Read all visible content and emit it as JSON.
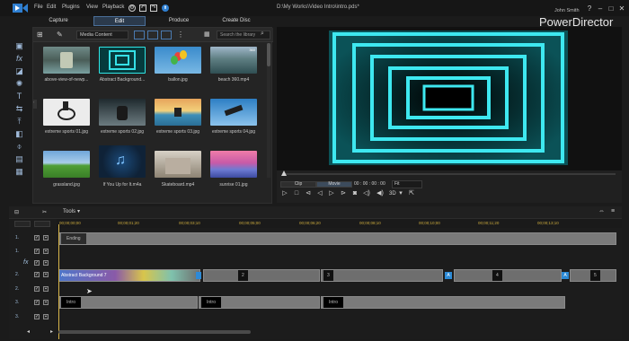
{
  "titlebar": {
    "menus": [
      "File",
      "Edit",
      "Plugins",
      "View",
      "Playback"
    ],
    "file_path": "D:\\My Works\\Video Intro\\intro.pds*",
    "user": "John Smith",
    "brand": "PowerDirector"
  },
  "modes": [
    "Capture",
    "Edit",
    "Produce",
    "Create Disc"
  ],
  "library": {
    "content_type": "Media Content",
    "search_placeholder": "Search the library",
    "items": [
      {
        "label": "above-view-of-newp..."
      },
      {
        "label": "Abstract Background..."
      },
      {
        "label": "ballon.jpg"
      },
      {
        "label": "beach 360.mp4",
        "badge": "360"
      },
      {
        "label": "extreme sports 01.jpg"
      },
      {
        "label": "extreme sports 02.jpg"
      },
      {
        "label": "extreme sports 03.jpg"
      },
      {
        "label": "extreme sports 04.jpg"
      },
      {
        "label": "grassland.jpg"
      },
      {
        "label": "If You Up for It.m4a"
      },
      {
        "label": "Skateboard.mp4"
      },
      {
        "label": "sunrise 01.jpg"
      }
    ]
  },
  "preview": {
    "modes": [
      "Clip",
      "Movie"
    ],
    "timecode": "00 : 00 : 00 : 00",
    "fit": "Fit",
    "three_d": "3D"
  },
  "timeline": {
    "tools_label": "Tools",
    "tracks": [
      "1.",
      "1.",
      "2.",
      "2.",
      "3.",
      "3."
    ],
    "ruler_ticks": [
      "00;00;00;00",
      "00;00;01;20",
      "00;00;03;10",
      "00;00;05;00",
      "00;00;06;20",
      "00;00;08;10",
      "00;00;10;00",
      "00;00;11;20",
      "00;00;13;10"
    ],
    "clip_labels": {
      "video1": "Ending",
      "fx_track": "Abstract Background 7",
      "seg2": "2",
      "seg3": "3",
      "seg4": "4",
      "seg5": "5",
      "audio3a": "Intro",
      "audio3b": "Intro",
      "audio3c": "Intro"
    }
  }
}
